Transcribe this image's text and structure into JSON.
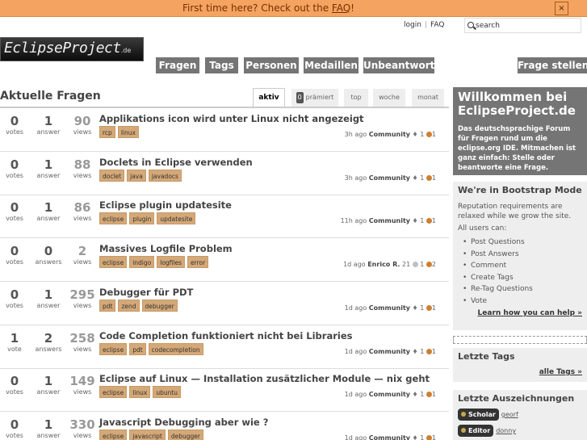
{
  "notify": {
    "prefix": "First time here? Check out the ",
    "link": "FAQ",
    "suffix": "!",
    "close": "×"
  },
  "top_links": {
    "login": "login",
    "faq": "FAQ"
  },
  "search": {
    "placeholder": "search"
  },
  "logo": {
    "name": "EclipseProject",
    "tld": ".de"
  },
  "nav": {
    "tabs": [
      "Fragen",
      "Tags",
      "Personen",
      "Medaillen",
      "Unbeantwortet"
    ],
    "ask": "Frage stellen"
  },
  "list": {
    "title": "Aktuelle Fragen",
    "tabs": {
      "aktiv": "aktiv",
      "praemiert_count": "0",
      "praemiert": "prämiert",
      "top": "top",
      "woche": "woche",
      "monat": "monat"
    }
  },
  "questions": [
    {
      "votes": "0",
      "votes_label": "votes",
      "answers": "1",
      "answers_label": "answer",
      "views": "90",
      "views_label": "views",
      "title": "Applikations icon wird unter Linux nicht angezeigt",
      "tags": [
        "rcp",
        "linux"
      ],
      "time": "3h ago",
      "user": "Community",
      "rep": "1",
      "badges": "1"
    },
    {
      "votes": "0",
      "votes_label": "votes",
      "answers": "1",
      "answers_label": "answer",
      "views": "88",
      "views_label": "views",
      "title": "Doclets in Eclipse verwenden",
      "tags": [
        "doclet",
        "java",
        "javadocs"
      ],
      "time": "3h ago",
      "user": "Community",
      "rep": "1",
      "badges": "1"
    },
    {
      "votes": "0",
      "votes_label": "votes",
      "answers": "1",
      "answers_label": "answer",
      "views": "86",
      "views_label": "views",
      "title": "Eclipse plugin updatesite",
      "tags": [
        "eclipse",
        "plugin",
        "updatesite"
      ],
      "time": "11h ago",
      "user": "Community",
      "rep": "1",
      "badges": "1"
    },
    {
      "votes": "0",
      "votes_label": "votes",
      "answers": "0",
      "answers_label": "answers",
      "views": "2",
      "views_label": "views",
      "title": "Massives Logfile Problem",
      "tags": [
        "eclipse",
        "indigo",
        "logfiles",
        "error"
      ],
      "time": "1d ago",
      "user": "Enrico R.",
      "rep": "21",
      "silver": "1",
      "badges": "2"
    },
    {
      "votes": "0",
      "votes_label": "votes",
      "answers": "1",
      "answers_label": "answer",
      "views": "295",
      "views_label": "views",
      "title": "Debugger für PDT",
      "tags": [
        "pdt",
        "zend",
        "debugger"
      ],
      "time": "1d ago",
      "user": "Community",
      "rep": "1",
      "badges": "1"
    },
    {
      "votes": "1",
      "votes_label": "vote",
      "answers": "2",
      "answers_label": "answers",
      "views": "258",
      "views_label": "views",
      "title": "Code Completion funktioniert nicht bei Libraries",
      "tags": [
        "eclipse",
        "pdt",
        "codecompletion"
      ],
      "time": "1d ago",
      "user": "Community",
      "rep": "1",
      "badges": "1"
    },
    {
      "votes": "0",
      "votes_label": "votes",
      "answers": "1",
      "answers_label": "answer",
      "views": "149",
      "views_label": "views",
      "title": "Eclipse auf Linux — Installation zusätzlicher Module — nix geht",
      "tags": [
        "eclipse",
        "linux",
        "ubuntu"
      ],
      "time": "1d ago",
      "user": "Community",
      "rep": "1",
      "badges": "1"
    },
    {
      "votes": "0",
      "votes_label": "votes",
      "answers": "1",
      "answers_label": "answer",
      "views": "330",
      "views_label": "views",
      "title": "Javascript Debugging aber wie ?",
      "tags": [
        "eclipse",
        "javascript",
        "debugger"
      ],
      "time": "1d ago",
      "user": "Community",
      "rep": "1",
      "badges": "1"
    }
  ],
  "sidebar": {
    "welcome_title": "Willkommen bei EclipseProject.de",
    "welcome_text": "Das deutschsprachige Forum für Fragen rund um die eclipse.org IDE. Mitmachen ist ganz einfach: Stelle oder beantworte eine Frage.",
    "bootstrap_title": "We're in Bootstrap Mode",
    "bootstrap_text": "Reputation requirements are relaxed while we grow the site.",
    "bootstrap_can": "All users can:",
    "bootstrap_items": [
      "Post Questions",
      "Post Answers",
      "Comment",
      "Create Tags",
      "Re-Tag Questions",
      "Vote"
    ],
    "bootstrap_more": "Learn how you can help »",
    "tags_title": "Letzte Tags",
    "tags_more": "alle Tags »",
    "awards_title": "Letzte Auszeichnungen",
    "awards": [
      {
        "badge": "Scholar",
        "user": "georf"
      },
      {
        "badge": "Editor",
        "user": "donny"
      }
    ]
  },
  "colors": {
    "notify": "#f4a460",
    "nav": "#757575",
    "tag": "#d4a877",
    "bronze": "#cd7f32",
    "silver": "#c0c0c0"
  }
}
